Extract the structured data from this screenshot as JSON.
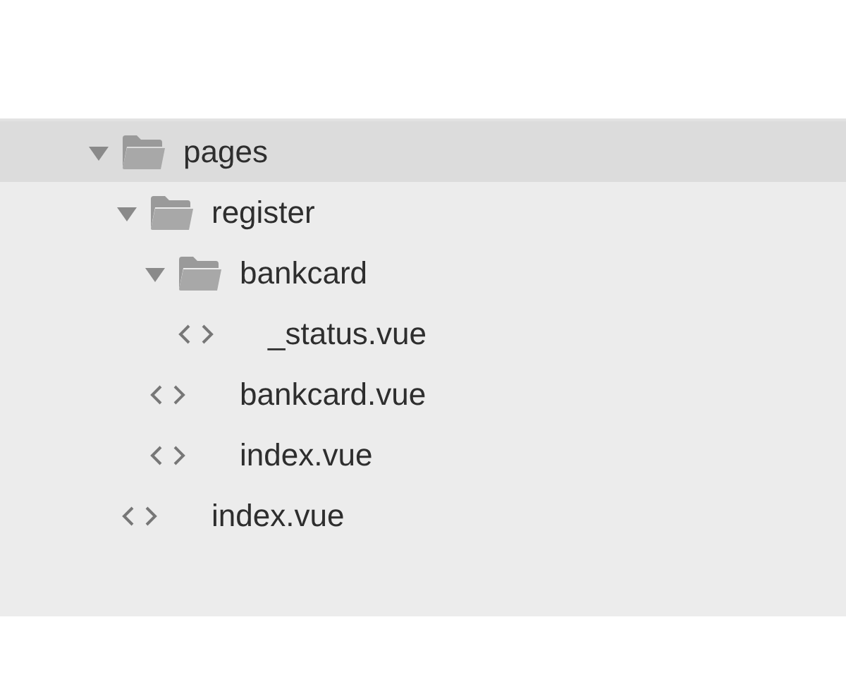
{
  "file_tree": [
    {
      "kind": "folder",
      "name": "pages",
      "expanded": true,
      "selected": true,
      "children": [
        {
          "kind": "folder",
          "name": "register",
          "expanded": true,
          "selected": false,
          "children": [
            {
              "kind": "folder",
              "name": "bankcard",
              "expanded": true,
              "selected": false,
              "children": [
                {
                  "kind": "file",
                  "name": "_status.vue",
                  "selected": false
                }
              ]
            },
            {
              "kind": "file",
              "name": "bankcard.vue",
              "selected": false
            },
            {
              "kind": "file",
              "name": "index.vue",
              "selected": false
            }
          ]
        },
        {
          "kind": "file",
          "name": "index.vue",
          "selected": false
        }
      ]
    }
  ]
}
